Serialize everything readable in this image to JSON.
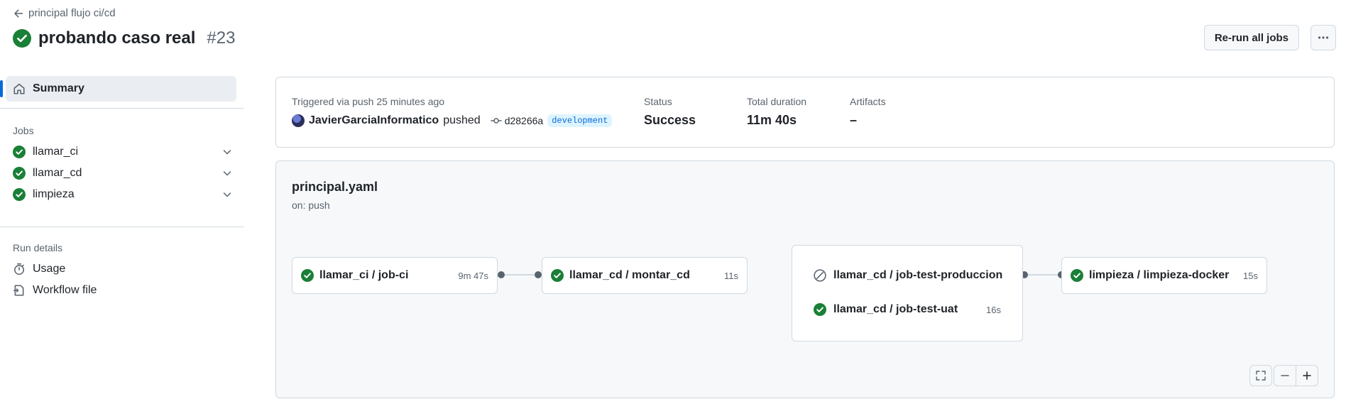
{
  "header": {
    "back_label": "principal flujo ci/cd",
    "title": "probando caso real",
    "run_number": "#23",
    "rerun_label": "Re-run all jobs"
  },
  "sidebar": {
    "summary_label": "Summary",
    "jobs_heading": "Jobs",
    "jobs": [
      {
        "label": "llamar_ci"
      },
      {
        "label": "llamar_cd"
      },
      {
        "label": "limpieza"
      }
    ],
    "details_heading": "Run details",
    "details": [
      {
        "label": "Usage",
        "icon": "stopwatch-icon"
      },
      {
        "label": "Workflow file",
        "icon": "workflow-file-icon"
      }
    ]
  },
  "summary": {
    "trigger_label": "Triggered via push 25 minutes ago",
    "actor": "JavierGarciaInformatico",
    "action": "pushed",
    "commit": "d28266a",
    "branch": "development",
    "status_label": "Status",
    "status_value": "Success",
    "duration_label": "Total duration",
    "duration_value": "11m 40s",
    "artifacts_label": "Artifacts",
    "artifacts_value": "–"
  },
  "graph": {
    "workflow_name": "principal.yaml",
    "trigger": "on: push",
    "jobs": [
      {
        "name": "llamar_ci / job-ci",
        "duration": "9m 47s",
        "status": "success"
      },
      {
        "name": "llamar_cd / montar_cd",
        "duration": "11s",
        "status": "success"
      },
      {
        "name": "limpieza / limpieza-docker",
        "duration": "15s",
        "status": "success"
      }
    ],
    "group": [
      {
        "name": "llamar_cd / job-test-produccion",
        "duration": "",
        "status": "skipped"
      },
      {
        "name": "llamar_cd / job-test-uat",
        "duration": "16s",
        "status": "success"
      }
    ]
  },
  "colors": {
    "success": "#1a7f37",
    "accent": "#0969da",
    "muted": "#59636e"
  }
}
